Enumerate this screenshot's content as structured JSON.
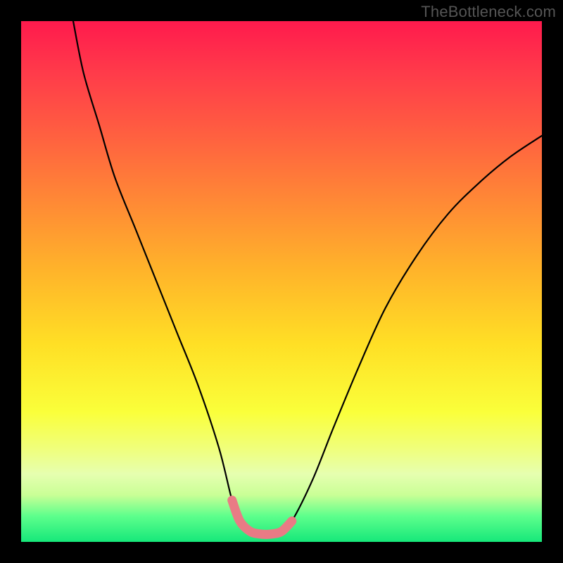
{
  "watermark": "TheBottleneck.com",
  "chart_data": {
    "type": "line",
    "title": "",
    "xlabel": "",
    "ylabel": "",
    "xlim": [
      0,
      100
    ],
    "ylim": [
      0,
      100
    ],
    "series": [
      {
        "name": "black-curve",
        "color": "#000000",
        "x": [
          10,
          12,
          15,
          18,
          22,
          26,
          30,
          34,
          38,
          40.5,
          42,
          44,
          46,
          48,
          50,
          52,
          56,
          60,
          65,
          70,
          76,
          82,
          88,
          94,
          100
        ],
        "y": [
          100,
          90,
          80,
          70,
          60,
          50,
          40,
          30,
          18,
          8,
          4,
          2,
          1.5,
          1.5,
          2,
          4,
          12,
          22,
          34,
          45,
          55,
          63,
          69,
          74,
          78
        ]
      },
      {
        "name": "pink-highlight",
        "color": "#e97b85",
        "x": [
          40.5,
          42,
          44,
          46,
          48,
          50,
          52
        ],
        "y": [
          8,
          4,
          2,
          1.5,
          1.5,
          2,
          4
        ]
      }
    ]
  }
}
